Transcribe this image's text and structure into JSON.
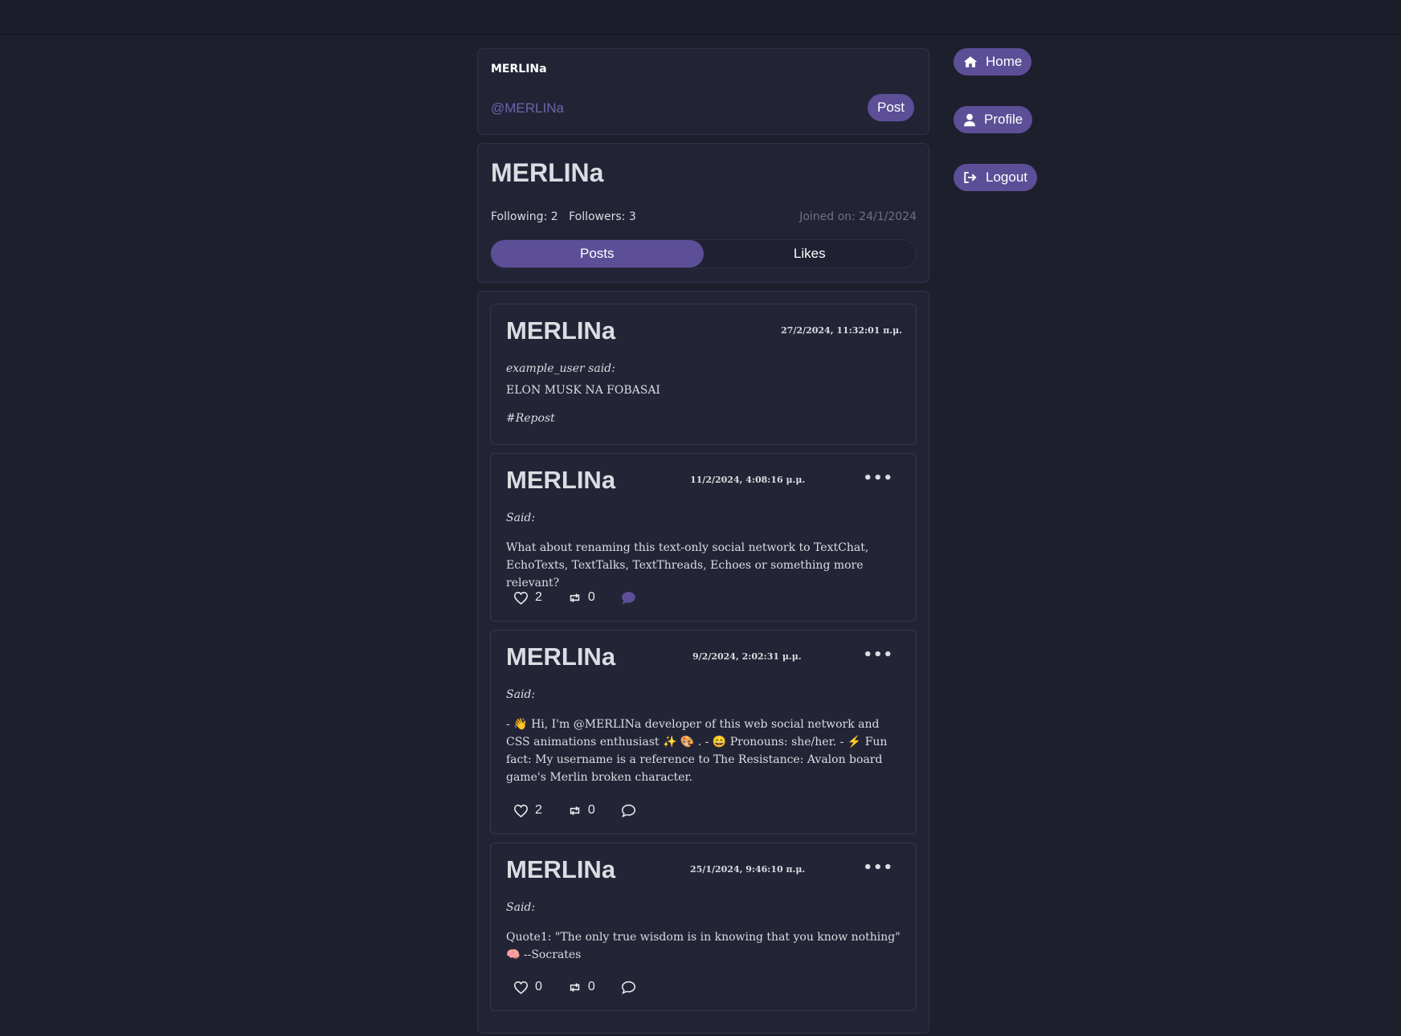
{
  "composer": {
    "username": "MERLINa",
    "handle": "@MERLINa",
    "post_label": "Post"
  },
  "profile": {
    "name": "MERLINa",
    "following": "Following: 2",
    "followers": "Followers: 3",
    "joined": "Joined on: 24/1/2024",
    "tabs": [
      {
        "label": "Posts",
        "active": true
      },
      {
        "label": "Likes",
        "active": false
      }
    ]
  },
  "posts": [
    {
      "author": "MERLINa",
      "date": "27/2/2024, 11:32:01 π.μ.",
      "said": "example_user said:",
      "body": "ELON MUSK NA FOBASAI",
      "tag": "#Repost"
    },
    {
      "author": "MERLINa",
      "date": "11/2/2024, 4:08:16 μ.μ.",
      "said": "Said:",
      "body": "What about renaming this text-only social network to TextChat, EchoTexts, TextTalks, TextThreads, Echoes or something more relevant?",
      "likes": "2",
      "reposts": "0",
      "comment_state": "filled"
    },
    {
      "author": "MERLINa",
      "date": "9/2/2024, 2:02:31 μ.μ.",
      "said": "Said:",
      "body": "- 👋 Hi, I'm @MERLINa developer of this web social network and CSS animations enthusiast ✨ 🎨 . - 😄 Pronouns: she/her. - ⚡ Fun fact: My username is a reference to The Resistance: Avalon board game's Merlin broken character.",
      "likes": "2",
      "reposts": "0",
      "comment_state": "outline"
    },
    {
      "author": "MERLINa",
      "date": "25/1/2024, 9:46:10 π.μ.",
      "said": "Said:",
      "body": "Quote1: \"The only true wisdom is in knowing that you know nothing\" 🧠 --Socrates",
      "likes": "0",
      "reposts": "0",
      "comment_state": "outline"
    }
  ],
  "nav": {
    "home": "Home",
    "profile": "Profile",
    "logout": "Logout"
  },
  "colors": {
    "accent": "#5c4f97",
    "background": "#1e1f2d",
    "card": "#222436",
    "handle": "#6e63a8"
  },
  "icons": {
    "more": "ellipsis-icon",
    "like": "heart-icon",
    "repost": "repost-icon",
    "comment": "comment-icon",
    "home": "home-icon",
    "profile": "user-icon",
    "logout": "logout-icon"
  }
}
